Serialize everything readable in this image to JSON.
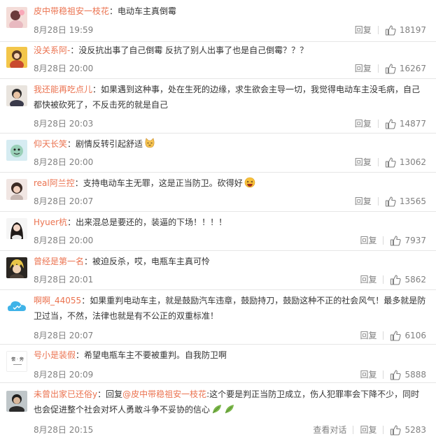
{
  "colors": {
    "username": "#eb7350",
    "meta": "#808080",
    "divider": "#e6e6e6"
  },
  "icons": {
    "like": "thumbs-up-icon"
  },
  "comments": [
    {
      "user": "皮中带稳祖安一枝花",
      "text": "：电动车主真倒霉",
      "time": "8月28日 19:59",
      "reply": "回复",
      "likes": "18197"
    },
    {
      "user": "没关系阿-",
      "text": "：没反抗出事了自己倒霉 反抗了别人出事了也是自己倒霉？？？",
      "time": "8月28日 20:00",
      "reply": "回复",
      "likes": "16267"
    },
    {
      "user": "我还能再吃点儿",
      "text": "：如果遇到这种事，处在生死的边缘，求生欲会主导一切，我觉得电动车主没毛病，自己都快被砍死了，不反击死的就是自己",
      "time": "8月28日 20:03",
      "reply": "回复",
      "likes": "14877"
    },
    {
      "user": "仰天长笑",
      "text": "：剧情反转引起舒适",
      "time": "8月28日 20:00",
      "reply": "回复",
      "likes": "13062"
    },
    {
      "user": "real阿兰控",
      "text": "：支持电动车主无罪，这是正当防卫。砍得好",
      "time": "8月28日 20:07",
      "reply": "回复",
      "likes": "13565"
    },
    {
      "user": "Hyuer杭",
      "text": "：出来混总是要还的，装逼的下场！！！！",
      "time": "8月28日 20:00",
      "reply": "回复",
      "likes": "7937"
    },
    {
      "user": "曾经是第一名",
      "text": "：被迫反杀，哎，电瓶车主真可怜",
      "time": "8月28日 20:01",
      "reply": "回复",
      "likes": "5862"
    },
    {
      "user": "啊啊_44055",
      "text": "：如果重判电动车主，就是鼓励汽车违章，鼓励持刀，鼓励这种不正的社会风气！最多就是防卫过当，不然，法律也就是有不公正的双重标准！",
      "time": "8月28日 20:07",
      "reply": "回复",
      "likes": "6106"
    },
    {
      "user": "号小是装假",
      "text": "：希望电瓶车主不要被重判。自我防卫啊",
      "time": "8月28日 20:09",
      "reply": "回复",
      "likes": "5888",
      "avatar_text": "懷 · 旁"
    },
    {
      "user": "未曾出家已还俗y",
      "text_a": "：回复",
      "mention": "@皮中带稳祖安一枝花",
      "text_b": ":这个要是判正当防卫成立，伤人犯罪率会下降不少，同时也会促进整个社会对坏人勇敢斗争不妥协的信心",
      "time": "8月28日 20:15",
      "view_chat": "查看对话",
      "reply": "回复",
      "likes": "5283"
    }
  ]
}
